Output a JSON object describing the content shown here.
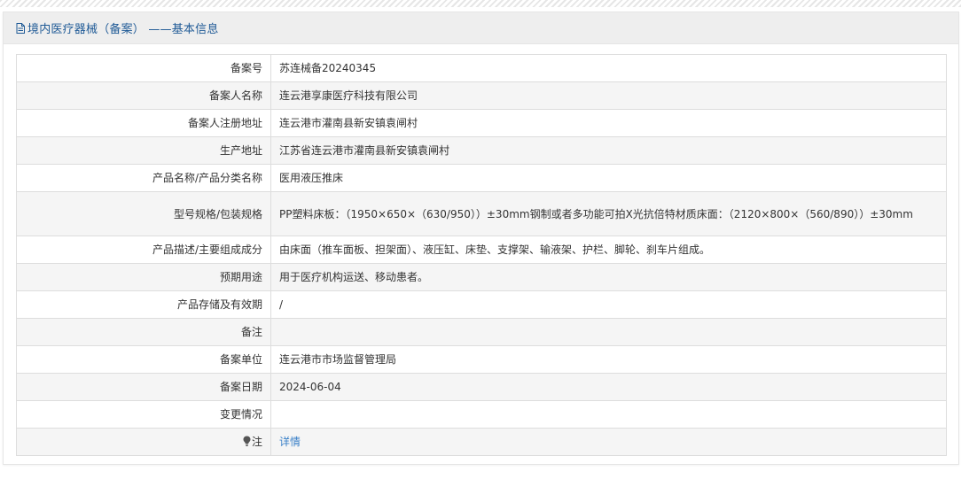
{
  "header": {
    "title": "境内医疗器械（备案） ——基本信息"
  },
  "rows": [
    {
      "label": "备案号",
      "value": "苏连械备20240345"
    },
    {
      "label": "备案人名称",
      "value": "连云港享康医疗科技有限公司"
    },
    {
      "label": "备案人注册地址",
      "value": "连云港市灌南县新安镇袁闸村"
    },
    {
      "label": "生产地址",
      "value": "江苏省连云港市灌南县新安镇袁闸村"
    },
    {
      "label": "产品名称/产品分类名称",
      "value": "医用液压推床"
    },
    {
      "label": "型号规格/包装规格",
      "value": "PP塑料床板：（1950×650×（630/950））±30mm钢制或者多功能可拍X光抗倍特材质床面：（2120×800×（560/890））±30mm"
    },
    {
      "label": "产品描述/主要组成成分",
      "value": "由床面（推车面板、担架面）、液压缸、床垫、支撑架、输液架、护栏、脚轮、刹车片组成。"
    },
    {
      "label": "预期用途",
      "value": "用于医疗机构运送、移动患者。"
    },
    {
      "label": "产品存储及有效期",
      "value": "/"
    },
    {
      "label": "备注",
      "value": ""
    },
    {
      "label": "备案单位",
      "value": "连云港市市场监督管理局"
    },
    {
      "label": "备案日期",
      "value": "2024-06-04"
    },
    {
      "label": "变更情况",
      "value": ""
    },
    {
      "label": "注",
      "value": "详情"
    }
  ],
  "icons": {
    "header_icon": "document-icon",
    "note_icon": "lightbulb-icon"
  },
  "colors": {
    "header_text": "#1f5a96",
    "link": "#3a80c8",
    "header_bg": "#eeeeee"
  }
}
